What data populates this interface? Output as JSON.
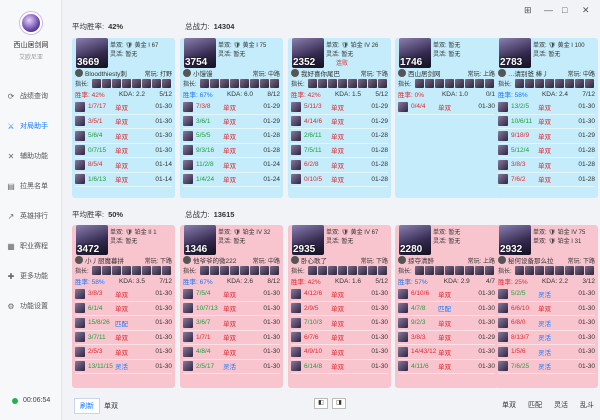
{
  "app": {
    "name": "西山居剑网",
    "sub": "艾欧尼亚",
    "timer": "00:06:54"
  },
  "nav": [
    {
      "label": "战绩查询",
      "icon": "clock-icon",
      "glyph": "⟳"
    },
    {
      "label": "对局助手",
      "icon": "swords-icon",
      "glyph": "⚔"
    },
    {
      "label": "辅助功能",
      "icon": "tools-icon",
      "glyph": "✕"
    },
    {
      "label": "拉黑名单",
      "icon": "list-icon",
      "glyph": "▤"
    },
    {
      "label": "英雄排行",
      "icon": "chart-icon",
      "glyph": "↗"
    },
    {
      "label": "职业赛程",
      "icon": "calendar-icon",
      "glyph": "▦"
    },
    {
      "label": "更多功能",
      "icon": "more-icon",
      "glyph": "✚"
    },
    {
      "label": "功能设置",
      "icon": "settings-icon",
      "glyph": "⚙"
    }
  ],
  "window": {
    "pin": "⊞",
    "min": "—",
    "max": "□",
    "close": "✕"
  },
  "team1": {
    "label": "平均胜率:",
    "winrate": "42%",
    "power_label": "总战力:",
    "power": "14304"
  },
  "team2": {
    "label": "平均胜率:",
    "winrate": "50%",
    "power_label": "总战力:",
    "power": "13615"
  },
  "players": [
    {
      "num": "3669",
      "rank": "单双: 🛡 黄金 I 67",
      "flex": "灵活: 暂无",
      "warn": "",
      "name": "Bloodthiesty刺",
      "pos": "常玩: 打野",
      "rate": "胜率: 42%",
      "rate_cls": "low",
      "kda": "KDA: 2.2",
      "games": "5/12",
      "rows": [
        [
          "1/7/17",
          "l",
          "单双",
          "01-30"
        ],
        [
          "3/5/1",
          "l",
          "单双",
          "01-30"
        ],
        [
          "5/6/4",
          "w",
          "单双",
          "01-30"
        ],
        [
          "0/7/15",
          "w",
          "单双",
          "01-30"
        ],
        [
          "8/5/4",
          "l",
          "单双",
          "01-14"
        ],
        [
          "1/6/13",
          "w",
          "单双",
          "01-14"
        ]
      ]
    },
    {
      "num": "3754",
      "rank": "单双: 🛡 黄金 I 75",
      "flex": "灵活: 暂无",
      "warn": "",
      "name": "小馒馒",
      "pos": "常玩: 中路",
      "rate": "胜率: 67%",
      "rate_cls": "mid",
      "kda": "KDA: 6.0",
      "games": "8/12",
      "rows": [
        [
          "7/3/8",
          "l",
          "单双",
          "01-29"
        ],
        [
          "3/6/1",
          "w",
          "单双",
          "01-29"
        ],
        [
          "5/5/5",
          "w",
          "单双",
          "01-28"
        ],
        [
          "9/3/16",
          "w",
          "单双",
          "01-28"
        ],
        [
          "11/2/8",
          "w",
          "单双",
          "01-24"
        ],
        [
          "1/4/24",
          "w",
          "单双",
          "01-24"
        ]
      ]
    },
    {
      "num": "2352",
      "rank": "单双: 🛡 铂金 IV 26",
      "flex": "灵活: 暂无",
      "warn": "连败",
      "name": "我好喜你尾巴",
      "pos": "常玩: 下路",
      "rate": "胜率: 42%",
      "rate_cls": "low",
      "kda": "KDA: 1.5",
      "games": "5/12",
      "rows": [
        [
          "5/11/3",
          "l",
          "单双",
          "01-29"
        ],
        [
          "4/14/6",
          "l",
          "单双",
          "01-29"
        ],
        [
          "2/6/11",
          "w",
          "单双",
          "01-28"
        ],
        [
          "7/5/11",
          "w",
          "单双",
          "01-28"
        ],
        [
          "6/2/8",
          "l",
          "单双",
          "01-28"
        ],
        [
          "0/10/5",
          "l",
          "单双",
          "01-28"
        ]
      ]
    },
    {
      "num": "1746",
      "rank": "单双: 暂无",
      "flex": "灵活: 暂无",
      "warn": "",
      "name": "西山居剑网",
      "pos": "常玩: 上路",
      "rate": "胜率: 0%",
      "rate_cls": "low",
      "kda": "KDA: 1.0",
      "games": "0/1",
      "rows": [
        [
          "0/4/4",
          "l",
          "单双",
          "01-30"
        ]
      ]
    },
    {
      "num": "2783",
      "rank": "单双: 🛡 黄金 I 100",
      "flex": "灵活: 暂无",
      "warn": "",
      "name": "…请别爸 棒丿",
      "pos": "常玩: 中路",
      "rate": "胜率: 58%",
      "rate_cls": "mid",
      "kda": "KDA: 2.4",
      "games": "7/12",
      "rows": [
        [
          "13/2/5",
          "w",
          "单双",
          "01-30"
        ],
        [
          "10/6/11",
          "w",
          "单双",
          "01-30"
        ],
        [
          "9/18/9",
          "l",
          "单双",
          "01-29"
        ],
        [
          "5/12/4",
          "w",
          "单双",
          "01-28"
        ],
        [
          "3/8/3",
          "l",
          "单双",
          "01-28"
        ],
        [
          "7/6/2",
          "l",
          "单双",
          "01-28"
        ]
      ]
    },
    {
      "num": "3472",
      "rank": "单双: 🛡 铂金 II 1",
      "flex": "灵活: 暂无",
      "warn": "",
      "name": "小丿厨魔暮拼",
      "pos": "常玩: 下路",
      "rate": "胜率: 58%",
      "rate_cls": "mid",
      "kda": "KDA: 3.5",
      "games": "7/12",
      "rows": [
        [
          "3/8/3",
          "l",
          "单双",
          "01-30"
        ],
        [
          "6/1/4",
          "w",
          "单双",
          "01-30"
        ],
        [
          "15/8/26",
          "w",
          "匹配",
          "01-30"
        ],
        [
          "3/7/11",
          "w",
          "单双",
          "01-30"
        ],
        [
          "2/5/3",
          "l",
          "单双",
          "01-30"
        ],
        [
          "13/11/15",
          "w",
          "灵活",
          "01-30"
        ]
      ]
    },
    {
      "num": "1346",
      "rank": "单双: 🛡 铂金 IV 32",
      "flex": "灵活: 暂无",
      "warn": "",
      "name": "他爷爷的微222",
      "pos": "常玩: 中路",
      "rate": "胜率: 67%",
      "rate_cls": "mid",
      "kda": "KDA: 2.6",
      "games": "8/12",
      "rows": [
        [
          "7/5/4",
          "w",
          "单双",
          "01-30"
        ],
        [
          "10/7/13",
          "w",
          "单双",
          "01-30"
        ],
        [
          "3/6/7",
          "w",
          "单双",
          "01-30"
        ],
        [
          "1/7/1",
          "l",
          "单双",
          "01-30"
        ],
        [
          "4/8/4",
          "w",
          "单双",
          "01-30"
        ],
        [
          "2/5/17",
          "w",
          "灵活",
          "01-30"
        ]
      ]
    },
    {
      "num": "2935",
      "rank": "单双: 🛡 黄金 IV 67",
      "flex": "灵活: 暂无",
      "warn": "",
      "name": "卧心歌了",
      "pos": "常玩: 下路",
      "rate": "胜率: 42%",
      "rate_cls": "low",
      "kda": "KDA: 1.6",
      "games": "5/12",
      "rows": [
        [
          "4/12/6",
          "l",
          "单双",
          "01-30"
        ],
        [
          "2/9/5",
          "l",
          "单双",
          "01-30"
        ],
        [
          "7/10/3",
          "w",
          "单双",
          "01-30"
        ],
        [
          "6/7/6",
          "l",
          "单双",
          "01-30"
        ],
        [
          "4/9/10",
          "l",
          "单双",
          "01-30"
        ],
        [
          "6/14/8",
          "w",
          "单双",
          "01-30"
        ]
      ]
    },
    {
      "num": "2280",
      "rank": "单双: 暂无",
      "flex": "灵活: 暂无",
      "warn": "",
      "name": "掠夺清醉",
      "pos": "常玩: 上路",
      "rate": "胜率: 57%",
      "rate_cls": "mid",
      "kda": "KDA: 2.9",
      "games": "4/7",
      "rows": [
        [
          "6/10/6",
          "l",
          "单双",
          "01-30"
        ],
        [
          "4/7/8",
          "w",
          "匹配",
          "01-30"
        ],
        [
          "9/2/3",
          "w",
          "单双",
          "01-30"
        ],
        [
          "3/8/3",
          "l",
          "单双",
          "01-29"
        ],
        [
          "14/43/12",
          "l",
          "单双",
          "01-30"
        ],
        [
          "4/11/6",
          "w",
          "单双",
          "01-30"
        ]
      ]
    },
    {
      "num": "2932",
      "rank": "单双: 🛡 铂金 IV 75",
      "flex": "单双: 🛡 铂金 I 31",
      "warn": "",
      "name": "秘何设备那么拉",
      "pos": "常玩: 下路",
      "rate": "胜率: 25%",
      "rate_cls": "low",
      "kda": "KDA: 2.2",
      "games": "3/12",
      "rows": [
        [
          "5/2/5",
          "w",
          "灵活",
          "01-30"
        ],
        [
          "6/6/10",
          "l",
          "单双",
          "01-30"
        ],
        [
          "6/8/0",
          "l",
          "灵活",
          "01-30"
        ],
        [
          "8/13/7",
          "l",
          "灵活",
          "01-30"
        ],
        [
          "1/5/6",
          "l",
          "灵活",
          "01-30"
        ],
        [
          "7/6/25",
          "w",
          "灵活",
          "01-30"
        ]
      ]
    }
  ],
  "bottom": {
    "tab1": "刷新",
    "tab2": "单双",
    "page_prev": "◧",
    "page_next": "◨",
    "f1": "单双",
    "f2": "匹配",
    "f3": "灵活",
    "f4": "乱斗"
  }
}
